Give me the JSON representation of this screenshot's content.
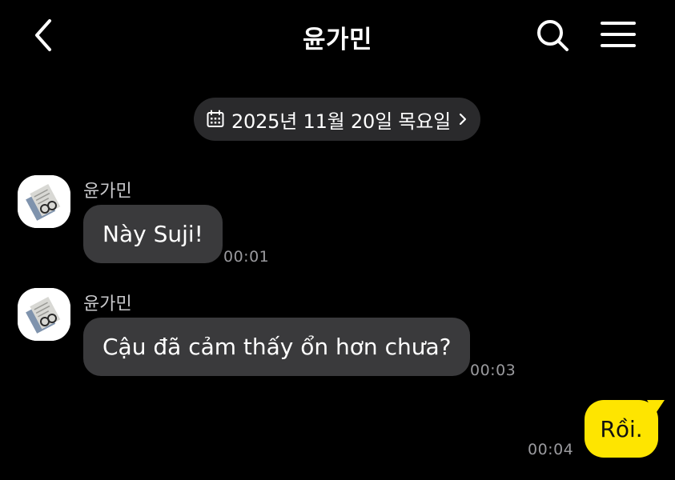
{
  "header": {
    "title": "윤가민",
    "back_icon": "chevron-left-icon",
    "search_icon": "search-icon",
    "menu_icon": "menu-icon"
  },
  "date_divider": {
    "icon": "calendar-icon",
    "text": "2025년 11월 20일 목요일",
    "chevron_icon": "chevron-right-icon"
  },
  "messages": [
    {
      "sender": "윤가민",
      "text": "Này Suji!",
      "time": "00:01"
    },
    {
      "sender": "윤가민",
      "text": "Cậu đã cảm thấy ổn hơn chưa?",
      "time": "00:03"
    }
  ],
  "my_messages": [
    {
      "text": "Rồi.",
      "time": "00:04"
    }
  ],
  "colors": {
    "background": "#000000",
    "incoming_bubble": "#3a3a3c",
    "outgoing_bubble": "#fee500",
    "date_pill": "#2a2a2c",
    "timestamp": "#9a9a9e"
  }
}
